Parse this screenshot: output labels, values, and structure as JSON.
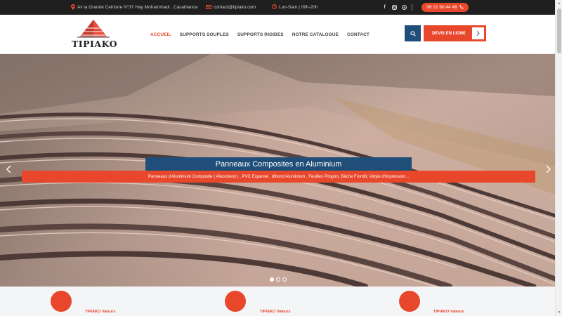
{
  "topbar": {
    "address": "Av la Grande Ceinture N°37 Hay Mohammadi , Casablanca",
    "address_icon": "map-pin-icon",
    "email": "contact@tipiako.com",
    "email_icon": "envelope-icon",
    "hours": "Lun-Sam | 09h-20h",
    "hours_icon": "clock-icon",
    "social_icons": [
      "facebook-icon",
      "instagram-icon",
      "whatsapp-icon"
    ],
    "phone": "06 22 60 44 46"
  },
  "header": {
    "logo_text": "TIPIAKO",
    "nav": [
      {
        "label": "ACCUEIL",
        "active": true
      },
      {
        "label": "SUPPORTS SOUPLES",
        "active": false
      },
      {
        "label": "SUPPORTS RIGIDES",
        "active": false
      },
      {
        "label": "NOTRE CATALOGUE",
        "active": false
      },
      {
        "label": "CONTACT",
        "active": false
      }
    ],
    "search_icon": "search-icon",
    "devis_label": "DEVIS EN LIGNE",
    "devis_arrow_icon": "chevron-right-icon"
  },
  "hero": {
    "title": "Panneaux Composites en Aluminium",
    "description": "Panneaux d'Aluminium Composite ( Alucobond ) , PVC Expansé , dibond Aluminium , Feuilles Polypro, Bâche Frontlit, Vinyle d'impression...",
    "prev_icon": "chevron-left-icon",
    "next_icon": "chevron-right-icon",
    "slides_count": 3,
    "active_slide": 1
  },
  "values": [
    {
      "label": "TIPIAKO Valeurs"
    },
    {
      "label": "TIPIAKO Valeurs"
    },
    {
      "label": "TIPIAKO Valeurs"
    }
  ],
  "colors": {
    "accent": "#e8472c",
    "primary": "#1f4e79",
    "topbar_bg": "#1f1f1f"
  }
}
